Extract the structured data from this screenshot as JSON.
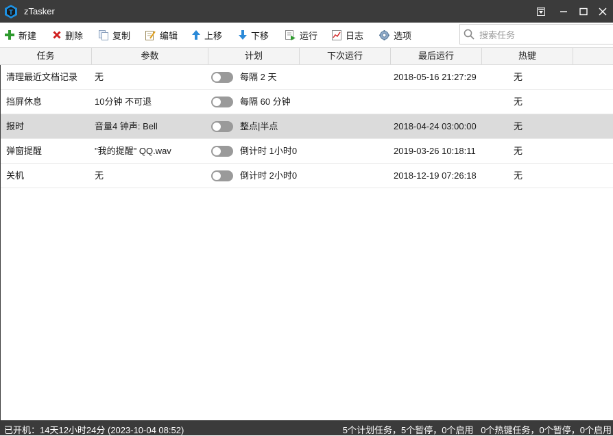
{
  "window": {
    "title": "zTasker",
    "logo_letter": "T",
    "controls": [
      "menu-icon",
      "minimize-icon",
      "maximize-icon",
      "close-icon"
    ]
  },
  "toolbar": {
    "new_label": "新建",
    "delete_label": "删除",
    "copy_label": "复制",
    "edit_label": "编辑",
    "move_up_label": "上移",
    "move_down_label": "下移",
    "run_label": "运行",
    "log_label": "日志",
    "options_label": "选项",
    "search_placeholder": "搜索任务"
  },
  "columns": {
    "task": "任务",
    "params": "参数",
    "plan": "计划",
    "next_run": "下次运行",
    "last_run": "最后运行",
    "hotkey": "热键"
  },
  "tasks": [
    {
      "name": "清理最近文档记录",
      "params": "无",
      "enabled": false,
      "plan": "每隔 2 天",
      "next_run": "",
      "last_run": "2018-05-16 21:27:29",
      "hotkey": "无"
    },
    {
      "name": "挡屏休息",
      "params": "10分钟 不可退",
      "enabled": false,
      "plan": "每隔 60 分钟",
      "next_run": "",
      "last_run": "",
      "hotkey": "无"
    },
    {
      "name": "报时",
      "params": "音量4 钟声: Bell",
      "enabled": false,
      "plan": "整点|半点",
      "next_run": "",
      "last_run": "2018-04-24 03:00:00",
      "hotkey": "无"
    },
    {
      "name": "弹窗提醒",
      "params": "\"我的提醒\" QQ.wav",
      "enabled": false,
      "plan": "倒计时 1小时0",
      "next_run": "",
      "last_run": "2019-03-26 10:18:11",
      "hotkey": "无"
    },
    {
      "name": "关机",
      "params": "无",
      "enabled": false,
      "plan": "倒计时 2小时0",
      "next_run": "",
      "last_run": "2018-12-19 07:26:18",
      "hotkey": "无"
    }
  ],
  "selected_row": 2,
  "status": {
    "uptime": "已开机：14天12小时24分 (2023-10-04 08:52)",
    "plan_summary": "5个计划任务，5个暂停，0个启用",
    "hotkey_summary": "0个热键任务，0个暂停，0个启用"
  },
  "colors": {
    "titlebar_bg": "#3b3b3b",
    "logo_blue": "#1e90e0",
    "toggle_off": "#9a9a9a",
    "selected_row_bg": "#dbdbdb",
    "add_green": "#2e9a2e",
    "delete_red": "#d02020",
    "arrow_blue": "#2b8ad8"
  }
}
